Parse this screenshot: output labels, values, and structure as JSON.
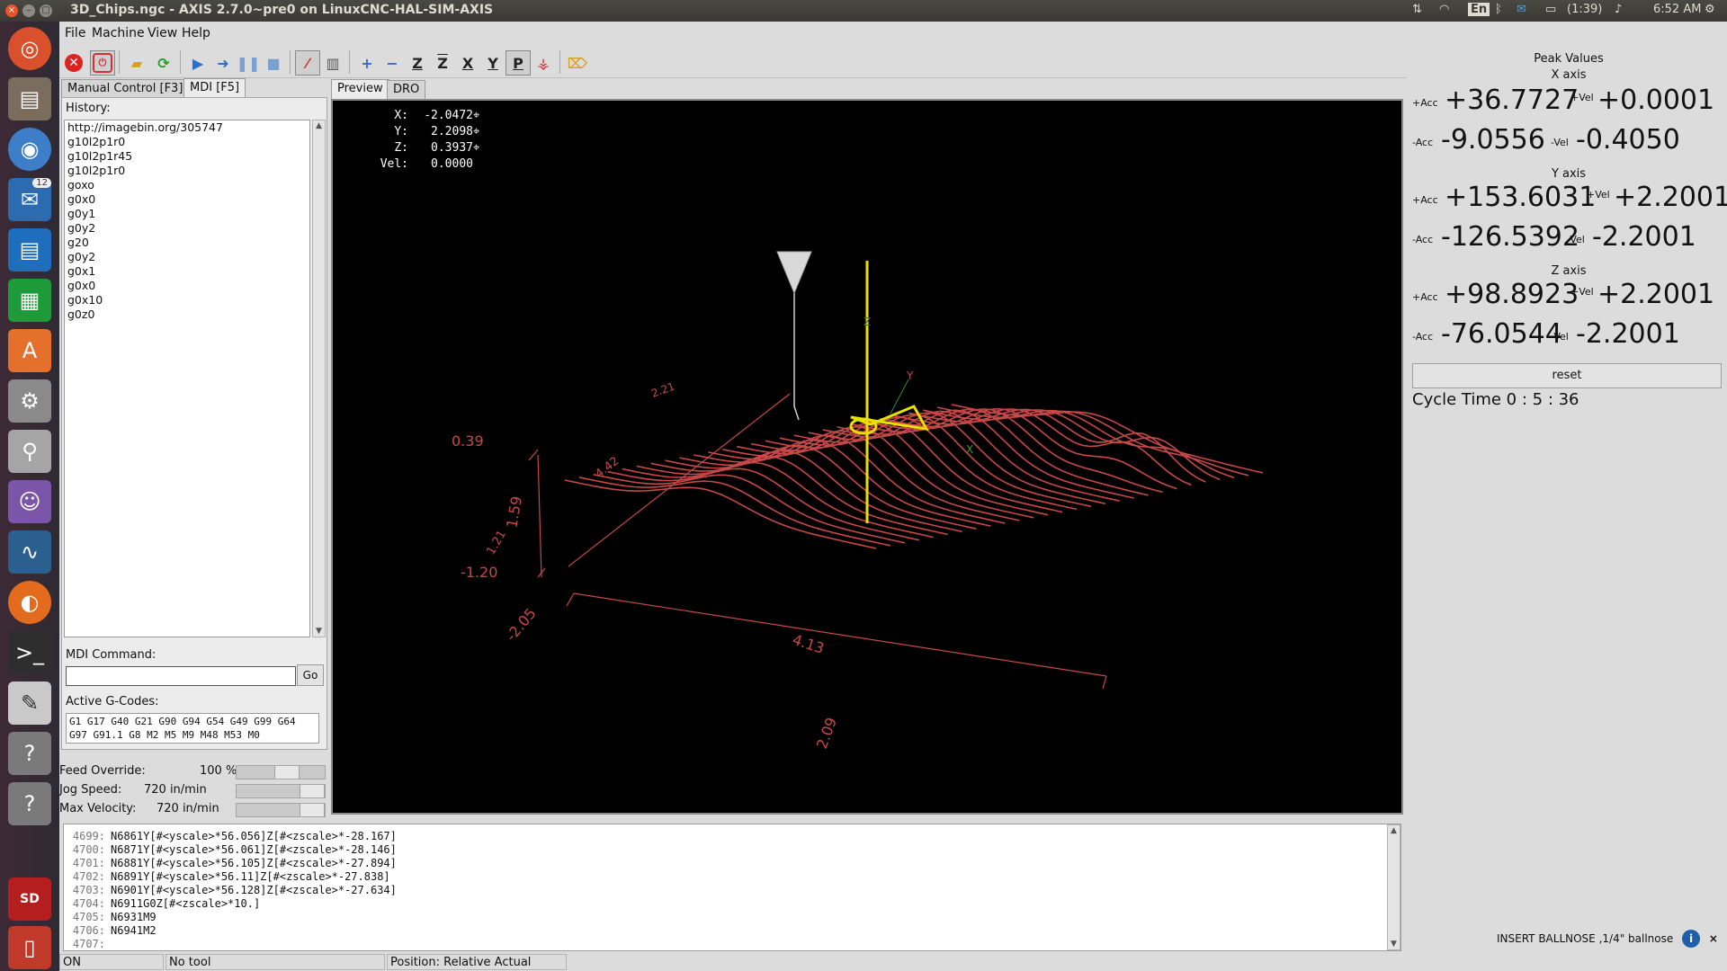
{
  "window": {
    "title": "3D_Chips.ngc - AXIS 2.7.0~pre0 on LinuxCNC-HAL-SIM-AXIS",
    "close_symbol": "×",
    "minimize_symbol": "–",
    "maximize_symbol": "▢"
  },
  "tray": {
    "keyboard_layout": "En",
    "battery": "(1:39)",
    "clock": "6:52 AM",
    "icons": [
      "network-icon",
      "wifi-icon",
      "bluetooth-icon",
      "mail-icon",
      "battery-icon",
      "volume-icon",
      "settings-gear-icon"
    ]
  },
  "launcher": {
    "icons": [
      "ubuntu-dash-icon",
      "file-manager-icon",
      "chromium-icon",
      "thunderbird-icon",
      "libreoffice-writer-icon",
      "libreoffice-calc-icon",
      "software-center-icon",
      "system-settings-icon",
      "disk-utility-icon",
      "pidgin-icon",
      "system-monitor-icon",
      "firefox-icon",
      "terminal-icon",
      "text-editor-icon",
      "help-icon",
      "help-icon-2",
      "sd-card-icon",
      "trash-icon"
    ],
    "thunderbird_badge": "12",
    "sd_label": "SD"
  },
  "menu": {
    "file": "File",
    "machine": "Machine",
    "view": "View",
    "help": "Help"
  },
  "toolbar": {
    "zoom_in": "+",
    "zoom_out": "−",
    "view_z": "Z",
    "view_z2": "Z",
    "view_x": "X",
    "view_y": "Y",
    "view_p": "P"
  },
  "left_tabs": {
    "manual": "Manual Control [F3]",
    "mdi": "MDI [F5]"
  },
  "history": {
    "label": "History:",
    "items": [
      "http://imagebin.org/305747",
      "g10l2p1r0",
      "g10l2p1r45",
      "g10l2p1r0",
      "goxo",
      "g0x0",
      "g0y1",
      "g0y2",
      "g20",
      "g0y2",
      "g0x1",
      "g0x0",
      "g0x10",
      "g0z0"
    ]
  },
  "mdi": {
    "label": "MDI Command:",
    "value": "",
    "go": "Go"
  },
  "active_gcodes": {
    "label": "Active G-Codes:",
    "line1": "G1 G17 G40 G21 G90 G94 G54 G49 G99 G64",
    "line2": "G97 G91.1 G8 M2 M5 M9 M48 M53 M0"
  },
  "sliders": {
    "feed_label": "Feed Override:",
    "feed_value": "100 %",
    "feed_fraction": 0.6,
    "jog_label": "Jog Speed:",
    "jog_value": "720 in/min",
    "jog_fraction": 1.0,
    "vel_label": "Max Velocity:",
    "vel_value": "720 in/min",
    "vel_fraction": 1.0
  },
  "preview_tabs": {
    "preview": "Preview",
    "dro": "DRO"
  },
  "dro": {
    "x_label": "X:",
    "x_value": "-2.0472",
    "y_label": "Y:",
    "y_value": "2.2098",
    "z_label": "Z:",
    "z_value": "0.3937",
    "vel_label": "Vel:",
    "vel_value": "0.0000"
  },
  "preview_dims": {
    "top_left": "2.21",
    "diag": "4.42",
    "z_top": "0.39",
    "z_span": "1.59",
    "z_mid": "1.21",
    "z_bottom": "-1.20",
    "x_left": "-2.05",
    "x_span": "4.13",
    "x_right": "2.09",
    "axis_y": "Y",
    "axis_z": "Z",
    "axis_x": "X"
  },
  "peak": {
    "title": "Peak Values",
    "x_axis": "X axis",
    "y_axis": "Y axis",
    "z_axis": "Z axis",
    "acc_pos": "+Acc",
    "acc_neg": "-Acc",
    "vel_pos": "+Vel",
    "vel_neg": "-Vel",
    "x_acc_pos": "+36.7727",
    "x_vel_pos": "+0.0001",
    "x_acc_neg": "-9.0556",
    "x_vel_neg": "-0.4050",
    "y_acc_pos": "+153.6031",
    "y_vel_pos": "+2.2001",
    "y_acc_neg": "-126.5392",
    "y_vel_neg": "-2.2001",
    "z_acc_pos": "+98.8923",
    "z_vel_pos": "+2.2001",
    "z_acc_neg": "-76.0544",
    "z_vel_neg": "-2.2001",
    "reset": "reset",
    "cycle_time": "Cycle Time  0 :  5 : 36"
  },
  "code": {
    "lines": [
      {
        "num": "4699:",
        "text": "N6861Y[#<yscale>*56.056]Z[#<zscale>*-28.167]"
      },
      {
        "num": "4700:",
        "text": "N6871Y[#<yscale>*56.061]Z[#<zscale>*-28.146]"
      },
      {
        "num": "4701:",
        "text": "N6881Y[#<yscale>*56.105]Z[#<zscale>*-27.894]"
      },
      {
        "num": "4702:",
        "text": "N6891Y[#<yscale>*56.11]Z[#<zscale>*-27.838]"
      },
      {
        "num": "4703:",
        "text": "N6901Y[#<yscale>*56.128]Z[#<zscale>*-27.634]"
      },
      {
        "num": "4704:",
        "text": "N6911G0Z[#<zscale>*10.]"
      },
      {
        "num": "4705:",
        "text": "N6931M9"
      },
      {
        "num": "4706:",
        "text": "N6941M2"
      },
      {
        "num": "4707:",
        "text": ""
      }
    ]
  },
  "notice": {
    "text": "INSERT BALLNOSE  ,1/4\" ballnose",
    "info": "i",
    "close": "×"
  },
  "status": {
    "state": "ON",
    "tool": "No tool",
    "position": "Position: Relative Actual"
  },
  "colors": {
    "toolpath": "#c84848",
    "tool_axis": "#e8e000",
    "canvas_bg": "#000000"
  }
}
